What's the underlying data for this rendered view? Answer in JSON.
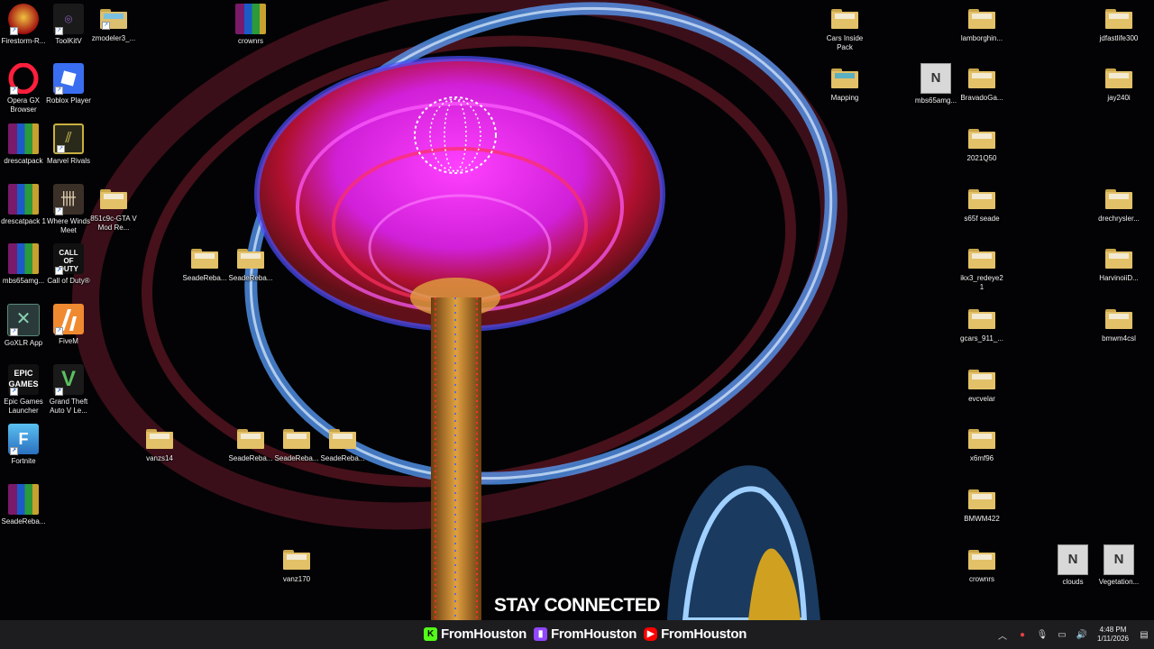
{
  "overlay": {
    "stay_connected": "STAY CONNECTED",
    "socials": [
      {
        "platform": "kick",
        "handle": "FromHouston",
        "color": "#53fc18"
      },
      {
        "platform": "twitch",
        "handle": "FromHouston",
        "color": "#9146ff"
      },
      {
        "platform": "youtube",
        "handle": "FromHouston",
        "color": "#ff0000"
      }
    ]
  },
  "desktop": {
    "icons": [
      {
        "id": "firestorm",
        "label": "Firestorm-R...",
        "type": "app"
      },
      {
        "id": "toolkitv",
        "label": "ToolKitV",
        "type": "app"
      },
      {
        "id": "zmodeler",
        "label": "zmodeler3_...",
        "type": "folder"
      },
      {
        "id": "crownrs1",
        "label": "crownrs",
        "type": "archive"
      },
      {
        "id": "opera",
        "label": "Opera GX Browser",
        "type": "app"
      },
      {
        "id": "roblox",
        "label": "Roblox Player",
        "type": "app"
      },
      {
        "id": "drescatpack",
        "label": "drescatpack",
        "type": "archive"
      },
      {
        "id": "marvel",
        "label": "Marvel Rivals",
        "type": "app"
      },
      {
        "id": "drescatpack1",
        "label": "drescatpack 1",
        "type": "archive"
      },
      {
        "id": "wherewinds",
        "label": "Where Winds Meet",
        "type": "app"
      },
      {
        "id": "gtamod",
        "label": "851c9c-GTA V Mod Re...",
        "type": "folder"
      },
      {
        "id": "mbs65amg1",
        "label": "mbs65amg...",
        "type": "archive"
      },
      {
        "id": "cod",
        "label": "Call of Duty®",
        "type": "app"
      },
      {
        "id": "goxlr",
        "label": "GoXLR App",
        "type": "app"
      },
      {
        "id": "fivem",
        "label": "FiveM",
        "type": "app"
      },
      {
        "id": "epic",
        "label": "Epic Games Launcher",
        "type": "app"
      },
      {
        "id": "gta5",
        "label": "Grand Theft Auto V Le...",
        "type": "app"
      },
      {
        "id": "fortnite",
        "label": "Fortnite",
        "type": "app"
      },
      {
        "id": "seadereba1",
        "label": "SeadeReba...",
        "type": "archive"
      },
      {
        "id": "seadereba2",
        "label": "SeadeReba...",
        "type": "folder"
      },
      {
        "id": "seadereba3",
        "label": "SeadeReba...",
        "type": "folder"
      },
      {
        "id": "vanzs14",
        "label": "vanzs14",
        "type": "folder"
      },
      {
        "id": "seadereba4",
        "label": "SeadeReba...",
        "type": "folder"
      },
      {
        "id": "seadereba5",
        "label": "SeadeReba...",
        "type": "folder"
      },
      {
        "id": "seadereba6",
        "label": "SeadeReba...",
        "type": "folder"
      },
      {
        "id": "vanz170",
        "label": "vanz170",
        "type": "folder"
      },
      {
        "id": "carsinside",
        "label": "Cars Inside Pack",
        "type": "folder"
      },
      {
        "id": "mapping",
        "label": "Mapping",
        "type": "folder"
      },
      {
        "id": "lamborghini",
        "label": "lamborghin...",
        "type": "folder"
      },
      {
        "id": "mbs65amg2",
        "label": "mbs65amg...",
        "type": "openiv"
      },
      {
        "id": "bravadoga",
        "label": "BravadoGa...",
        "type": "folder"
      },
      {
        "id": "2021q50",
        "label": "2021Q50",
        "type": "folder"
      },
      {
        "id": "s65fseade",
        "label": "s65f seade",
        "type": "folder"
      },
      {
        "id": "ikx3",
        "label": "ikx3_redeye21",
        "type": "folder"
      },
      {
        "id": "gcars911",
        "label": "gcars_911_...",
        "type": "folder"
      },
      {
        "id": "evcvelar",
        "label": "evcvelar",
        "type": "folder"
      },
      {
        "id": "x6mf96",
        "label": "x6mf96",
        "type": "folder"
      },
      {
        "id": "bmwm422",
        "label": "BMWM422",
        "type": "folder"
      },
      {
        "id": "crownrs2",
        "label": "crownrs",
        "type": "folder"
      },
      {
        "id": "jdfast",
        "label": "jdfastlife300",
        "type": "folder"
      },
      {
        "id": "jay240i",
        "label": "jay240i",
        "type": "folder"
      },
      {
        "id": "drechrysler",
        "label": "drechrysler...",
        "type": "folder"
      },
      {
        "id": "harvinoid",
        "label": "HarvinoiiD...",
        "type": "folder"
      },
      {
        "id": "bmwm4csl",
        "label": "bmwm4csl",
        "type": "folder"
      },
      {
        "id": "clouds",
        "label": "clouds",
        "type": "openiv"
      },
      {
        "id": "vegetation",
        "label": "Vegetation...",
        "type": "openiv"
      }
    ]
  },
  "taskbar": {
    "time": "4:48 PM",
    "date": "1/11/2026"
  }
}
